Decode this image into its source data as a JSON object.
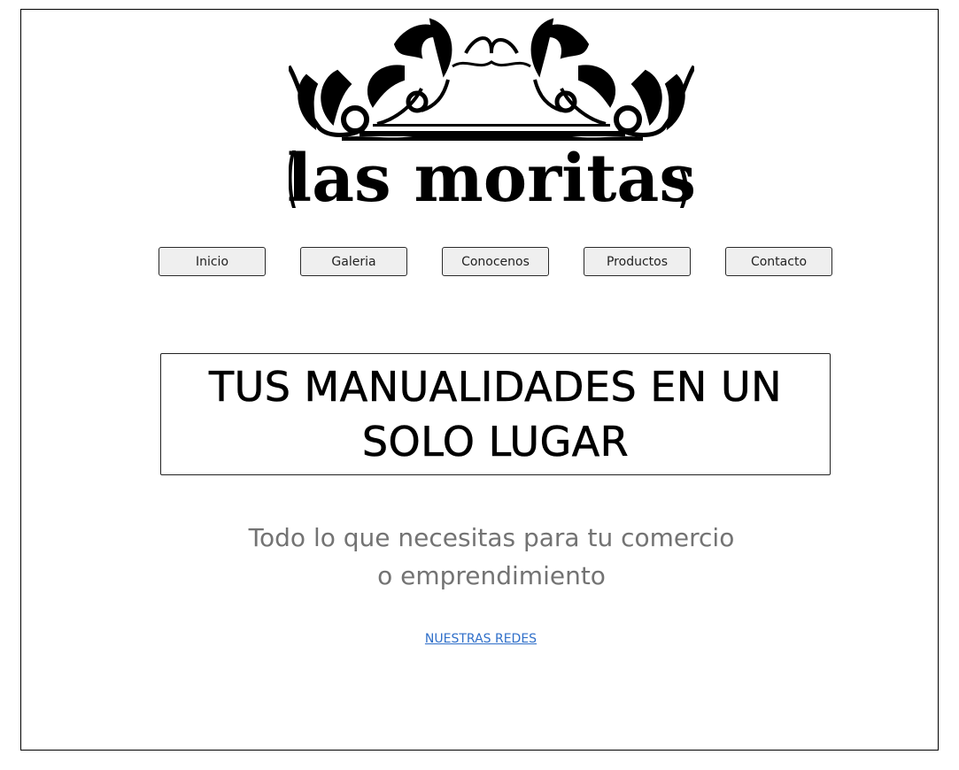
{
  "brand": {
    "logo_text": "las moritas"
  },
  "nav": {
    "items": [
      {
        "label": "Inicio"
      },
      {
        "label": "Galeria"
      },
      {
        "label": "Conocenos"
      },
      {
        "label": "Productos"
      },
      {
        "label": "Contacto"
      }
    ]
  },
  "hero": {
    "title": "TUS MANUALIDADES EN UN SOLO LUGAR"
  },
  "tagline": {
    "text": "Todo lo que necesitas para tu comercio o emprendimiento"
  },
  "social": {
    "link_text": "NUESTRAS REDES"
  },
  "colors": {
    "link": "#2f6fc9",
    "subtitle": "#737373",
    "button_bg": "#efefef"
  }
}
